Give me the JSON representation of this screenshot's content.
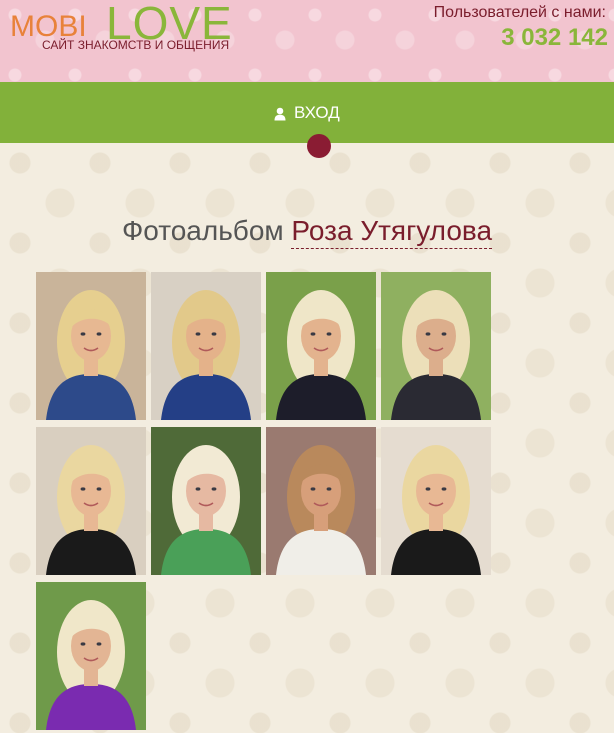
{
  "header": {
    "logo_mobi": "MOBI",
    "logo_love": "LOVE",
    "tagline": "САЙТ ЗНАКОМСТВ И ОБЩЕНИЯ",
    "users_label": "Пользователей с нами:",
    "users_count": "3 032 142"
  },
  "nav": {
    "login_label": "ВХОД",
    "login_icon": "user-icon"
  },
  "album": {
    "title_prefix": "Фотоальбом",
    "owner_name": "Роза Утягулова"
  },
  "colors": {
    "header_bg": "#f2c4cf",
    "nav_bg": "#82b13a",
    "accent_dark": "#7a1d2c",
    "logo_orange": "#e8823a",
    "logo_green": "#8ab63a",
    "page_bg": "#f3ede0"
  },
  "photos": [
    {
      "bg": "#c9b49a",
      "hair": "#e6cf8f",
      "cloth": "#2d4a8a",
      "skin": "#e7b892"
    },
    {
      "bg": "#d8d0c4",
      "hair": "#e2c98a",
      "cloth": "#243f86",
      "skin": "#e4b28a"
    },
    {
      "bg": "#7aa04a",
      "hair": "#efe6c8",
      "cloth": "#1d1d2a",
      "skin": "#e3b38e"
    },
    {
      "bg": "#8fb060",
      "hair": "#ecdfb9",
      "cloth": "#2a2a33",
      "skin": "#dcae8c"
    },
    {
      "bg": "#d9cfc0",
      "hair": "#ead7a0",
      "cloth": "#1a1a1a",
      "skin": "#e8b894"
    },
    {
      "bg": "#4f6a38",
      "hair": "#f2ead4",
      "cloth": "#4aa058",
      "skin": "#e6b9a2"
    },
    {
      "bg": "#9a7a70",
      "hair": "#b9895c",
      "cloth": "#f0eee8",
      "skin": "#d79f7a"
    },
    {
      "bg": "#e5dcd0",
      "hair": "#ead7a0",
      "cloth": "#1a1a1a",
      "skin": "#e8b894"
    },
    {
      "bg": "#6f9a4a",
      "hair": "#f0e7c9",
      "cloth": "#7a2bb0",
      "skin": "#e3b594"
    }
  ]
}
